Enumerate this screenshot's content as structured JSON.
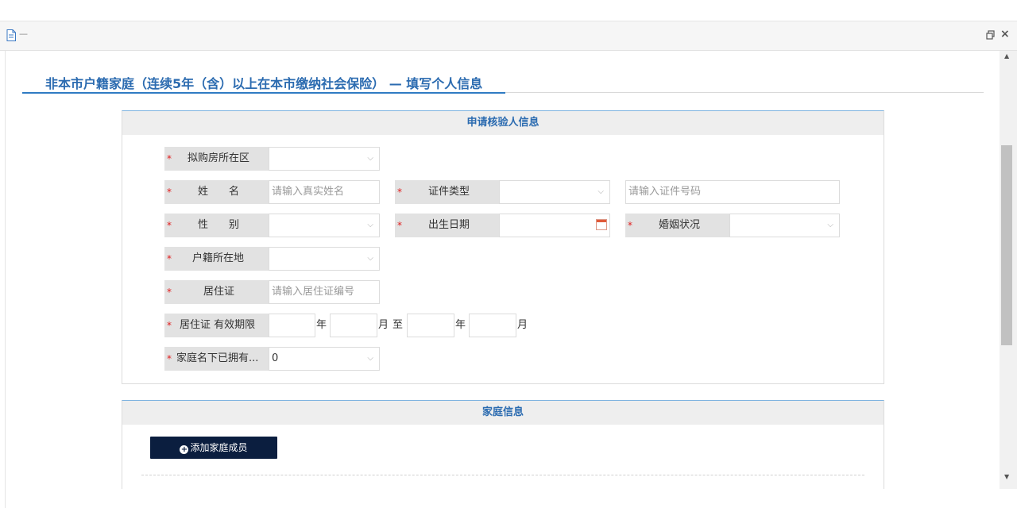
{
  "window": {
    "title": "—",
    "restore_icon": "restore-icon",
    "close_label": "×"
  },
  "page": {
    "title": "非本市户籍家庭（连续5年（含）以上在本市缴纳社会保险） — 填写个人信息"
  },
  "applicant_section": {
    "header": "申请核验人信息",
    "required_mark": "*",
    "district": {
      "label": "拟购房所在区",
      "value": ""
    },
    "name": {
      "label": "姓　　名",
      "placeholder": "请输入真实姓名"
    },
    "id_type": {
      "label": "证件类型",
      "value": ""
    },
    "id_number": {
      "placeholder": "请输入证件号码"
    },
    "gender": {
      "label": "性　　别",
      "value": ""
    },
    "birth_date": {
      "label": "出生日期",
      "value": ""
    },
    "marital_status": {
      "label": "婚姻状况",
      "value": ""
    },
    "household_registration": {
      "label": "户籍所在地",
      "value": ""
    },
    "residence_permit": {
      "label": "居住证",
      "placeholder": "请输入居住证编号"
    },
    "permit_validity": {
      "label": "居住证 有效期限",
      "year_unit": "年",
      "month_unit": "月",
      "to_text": "至"
    },
    "owned_homes": {
      "label": "家庭名下已拥有...",
      "value": "0"
    }
  },
  "family_section": {
    "header": "家庭信息",
    "add_member_button": "添加家庭成员"
  },
  "colors": {
    "accent_blue": "#2b6bb0",
    "button_navy": "#0b1e3f",
    "required_red": "#e02020"
  }
}
